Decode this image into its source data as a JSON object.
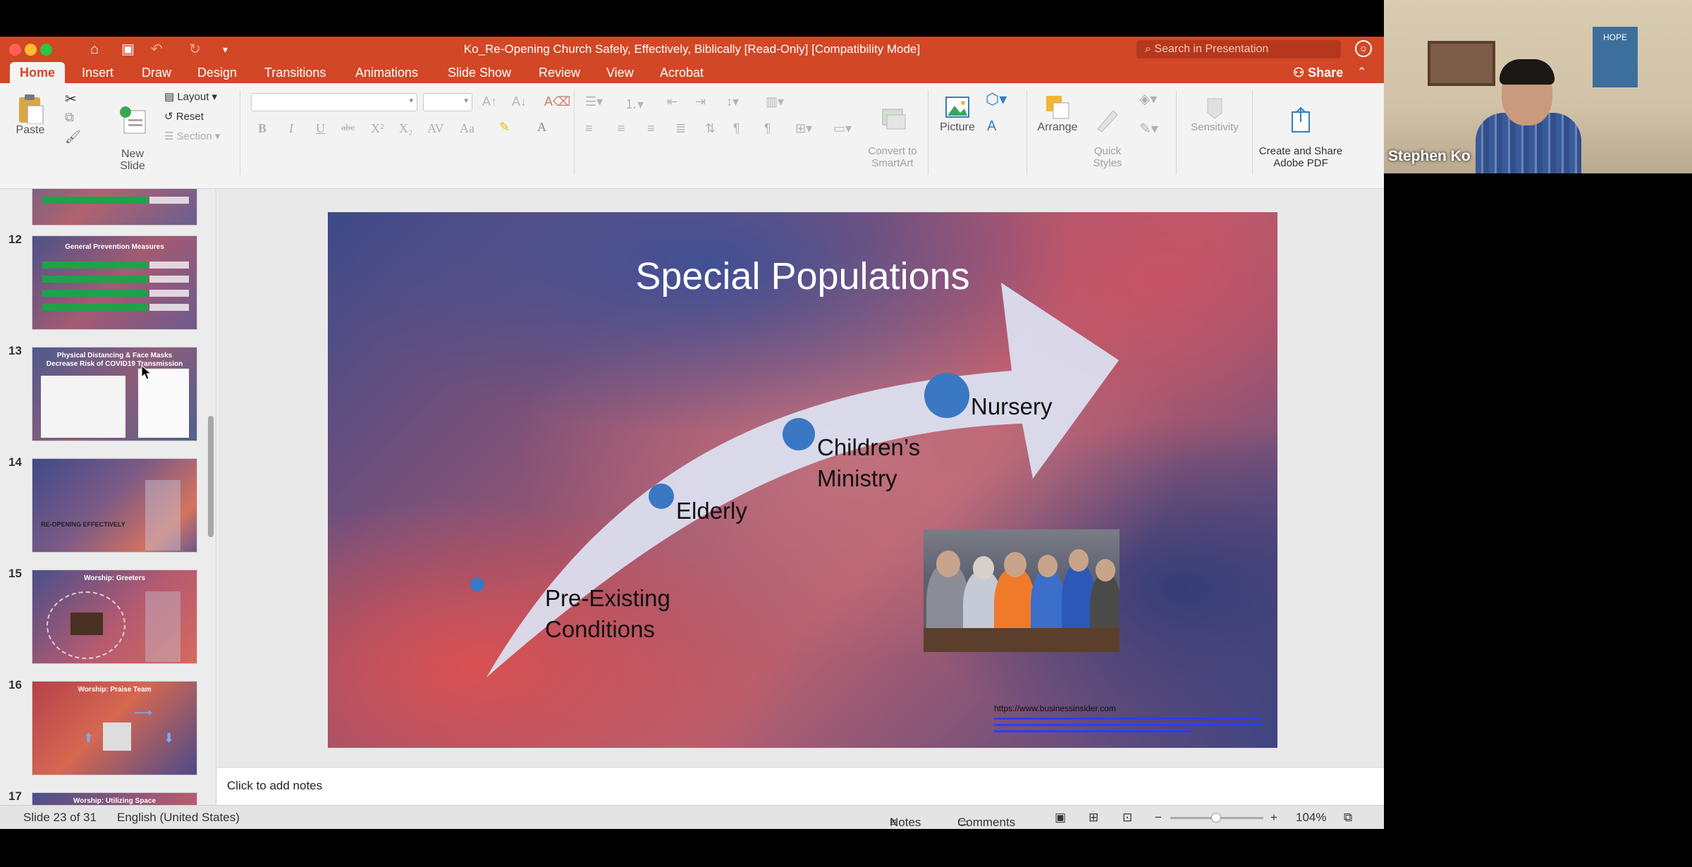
{
  "window": {
    "title": "Ko_Re-Opening Church Safely, Effectively, Biblically [Read-Only] [Compatibility Mode]",
    "search_placeholder": "Search in Presentation"
  },
  "tabs": [
    "Home",
    "Insert",
    "Draw",
    "Design",
    "Transitions",
    "Animations",
    "Slide Show",
    "Review",
    "View",
    "Acrobat"
  ],
  "share_label": "Share",
  "ribbon": {
    "paste": "Paste",
    "new_slide": "New\nSlide",
    "layout": "Layout",
    "reset": "Reset",
    "section": "Section",
    "convert_smartart": "Convert to\nSmartArt",
    "picture": "Picture",
    "arrange": "Arrange",
    "quick_styles": "Quick\nStyles",
    "sensitivity": "Sensitivity",
    "create_share_pdf": "Create and Share\nAdobe PDF"
  },
  "thumbnails": [
    {
      "num": "12",
      "title": "General Prevention Measures"
    },
    {
      "num": "13",
      "title": "Physical Distancing & Face Masks Decrease Risk of COVID19 Transmission"
    },
    {
      "num": "14",
      "title": "RE-OPENING EFFECTIVELY"
    },
    {
      "num": "15",
      "title": "Worship: Greeters"
    },
    {
      "num": "16",
      "title": "Worship: Praise Team"
    },
    {
      "num": "17",
      "title": "Worship: Utilizing Space"
    }
  ],
  "slide": {
    "title": "Special Populations",
    "labels": {
      "pre_existing": "Pre-Existing\nConditions",
      "elderly": "Elderly",
      "childrens": "Children’s\nMinistry",
      "nursery": "Nursery"
    },
    "source": "https://www.businessinsider.com"
  },
  "notes_placeholder": "Click to add notes",
  "status": {
    "slide": "Slide 23 of 31",
    "language": "English (United States)",
    "notes": "Notes",
    "comments": "Comments",
    "zoom": "104%"
  },
  "webcam": {
    "name": "Stephen Ko",
    "poster_text": "HOPE"
  },
  "colors": {
    "accent": "#d24726",
    "dot": "#3a78c4"
  }
}
